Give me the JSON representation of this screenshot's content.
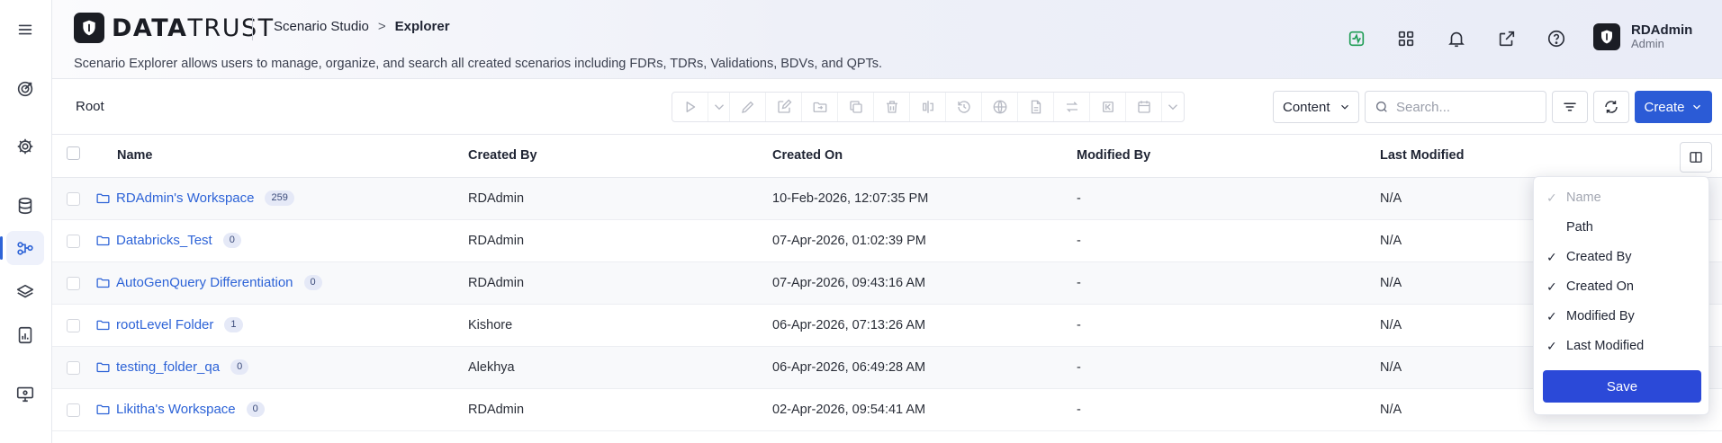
{
  "brand": {
    "name_bold": "DATA",
    "name_light": "TRUST"
  },
  "breadcrumb": {
    "parent": "Scenario Studio",
    "separator": ">",
    "current": "Explorer"
  },
  "description": "Scenario Explorer allows users to manage, organize, and search all created scenarios including FDRs, TDRs, Validations, BDVs, and QPTs.",
  "user": {
    "name": "RDAdmin",
    "role": "Admin"
  },
  "toolbar": {
    "root_label": "Root",
    "content_select": "Content",
    "search_placeholder": "Search...",
    "create_label": "Create"
  },
  "table": {
    "columns": [
      "Name",
      "Created By",
      "Created On",
      "Modified By",
      "Last Modified"
    ],
    "rows": [
      {
        "name": "RDAdmin's Workspace",
        "count": "259",
        "created_by": "RDAdmin",
        "created_on": "10-Feb-2026, 12:07:35 PM",
        "modified_by": "-",
        "last_modified": "N/A"
      },
      {
        "name": "Databricks_Test",
        "count": "0",
        "created_by": "RDAdmin",
        "created_on": "07-Apr-2026, 01:02:39 PM",
        "modified_by": "-",
        "last_modified": "N/A"
      },
      {
        "name": "AutoGenQuery Differentiation",
        "count": "0",
        "created_by": "RDAdmin",
        "created_on": "07-Apr-2026, 09:43:16 AM",
        "modified_by": "-",
        "last_modified": "N/A"
      },
      {
        "name": "rootLevel Folder",
        "count": "1",
        "created_by": "Kishore",
        "created_on": "06-Apr-2026, 07:13:26 AM",
        "modified_by": "-",
        "last_modified": "N/A"
      },
      {
        "name": "testing_folder_qa",
        "count": "0",
        "created_by": "Alekhya",
        "created_on": "06-Apr-2026, 06:49:28 AM",
        "modified_by": "-",
        "last_modified": "N/A"
      },
      {
        "name": "Likitha's Workspace",
        "count": "0",
        "created_by": "RDAdmin",
        "created_on": "02-Apr-2026, 09:54:41 AM",
        "modified_by": "-",
        "last_modified": "N/A"
      }
    ]
  },
  "column_menu": {
    "options": [
      {
        "label": "Name",
        "checked": true,
        "disabled": true
      },
      {
        "label": "Path",
        "checked": false,
        "disabled": false
      },
      {
        "label": "Created By",
        "checked": true,
        "disabled": false
      },
      {
        "label": "Created On",
        "checked": true,
        "disabled": false
      },
      {
        "label": "Modified By",
        "checked": true,
        "disabled": false
      },
      {
        "label": "Last Modified",
        "checked": true,
        "disabled": false
      }
    ],
    "tick_glyph": "✓",
    "save_label": "Save"
  },
  "colors": {
    "primary": "#2b5bd6",
    "link": "#2d63d7",
    "save": "#2b49d8",
    "activity_icon": "#1f9d55"
  },
  "icons": {
    "rail": [
      "menu-icon",
      "target-icon",
      "gear-icon",
      "database-icon",
      "workflow-icon",
      "layers-icon",
      "report-icon",
      "monitor-icon"
    ],
    "header": [
      "activity-icon",
      "apps-grid-icon",
      "bell-icon",
      "external-link-icon",
      "help-icon"
    ]
  }
}
